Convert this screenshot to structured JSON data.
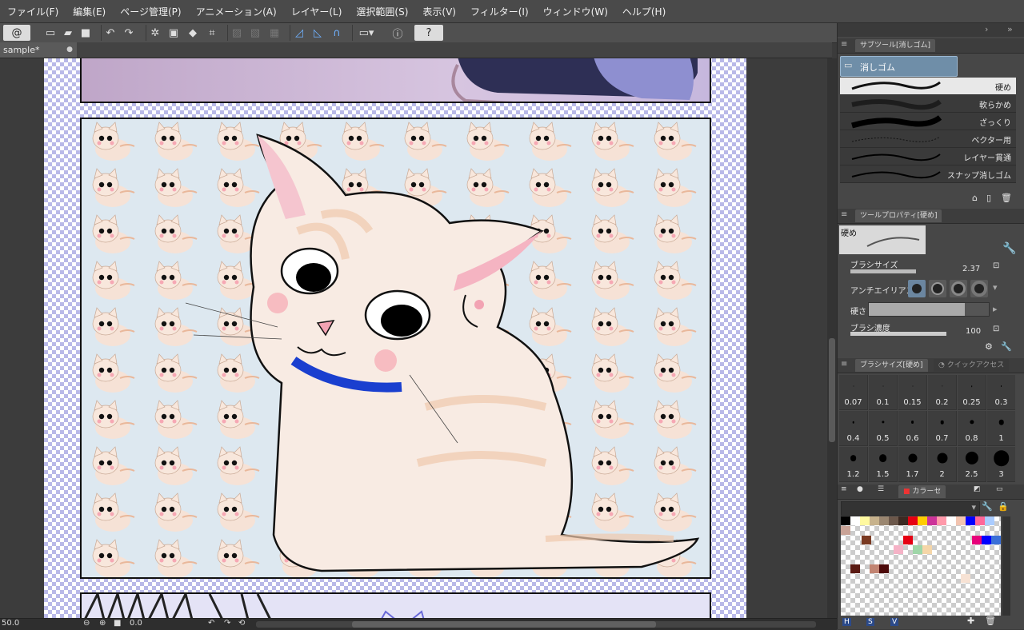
{
  "menu": [
    "ファイル(F)",
    "編集(E)",
    "ページ管理(P)",
    "アニメーション(A)",
    "レイヤー(L)",
    "選択範囲(S)",
    "表示(V)",
    "フィルター(I)",
    "ウィンドウ(W)",
    "ヘルプ(H)"
  ],
  "document_tab": "sample*",
  "status": {
    "zoom": "50.0",
    "angle": "0.0"
  },
  "subtool_panel": {
    "tab_label": "サブツール[消しゴム]",
    "group_label": "消しゴム",
    "brushes": [
      "硬め",
      "軟らかめ",
      "ざっくり",
      "ベクター用",
      "レイヤー貫通",
      "スナップ消しゴム"
    ],
    "selected_brush": "硬め"
  },
  "tool_property": {
    "tab_label": "ツールプロパティ[硬め]",
    "preview_label": "硬め",
    "brush_size_label": "ブラシサイズ",
    "brush_size_value": "2.37",
    "antialias_label": "アンチエイリアス",
    "hardness_label": "硬さ",
    "density_label": "ブラシ濃度",
    "density_value": "100"
  },
  "brush_size_panel": {
    "tab_label": "ブラシサイズ[硬め]",
    "quick_access_label": "クイックアクセス",
    "sizes": [
      "0.07",
      "0.1",
      "0.15",
      "0.2",
      "0.25",
      "0.3",
      "0.4",
      "0.5",
      "0.6",
      "0.7",
      "0.8",
      "1",
      "1.2",
      "1.5",
      "1.7",
      "2",
      "2.5",
      "3"
    ]
  },
  "color_panel": {
    "tab_label": "カラーセ",
    "bottom_letters": [
      "H",
      "S",
      "V"
    ],
    "swatches": [
      "#000000",
      "#ffffff",
      "#fff9a0",
      "#c7b28c",
      "#9a8670",
      "#6b574a",
      "#3c2a22",
      "#e60012",
      "#ffcc00",
      "#cc3399",
      "#ff99aa",
      "#ffffff",
      "#f2c4b0",
      "#0000ff",
      "#ff6699",
      "#aaccff"
    ]
  },
  "colors": {
    "accent": "#2a5f9e",
    "collar": "#1a3fcf"
  }
}
